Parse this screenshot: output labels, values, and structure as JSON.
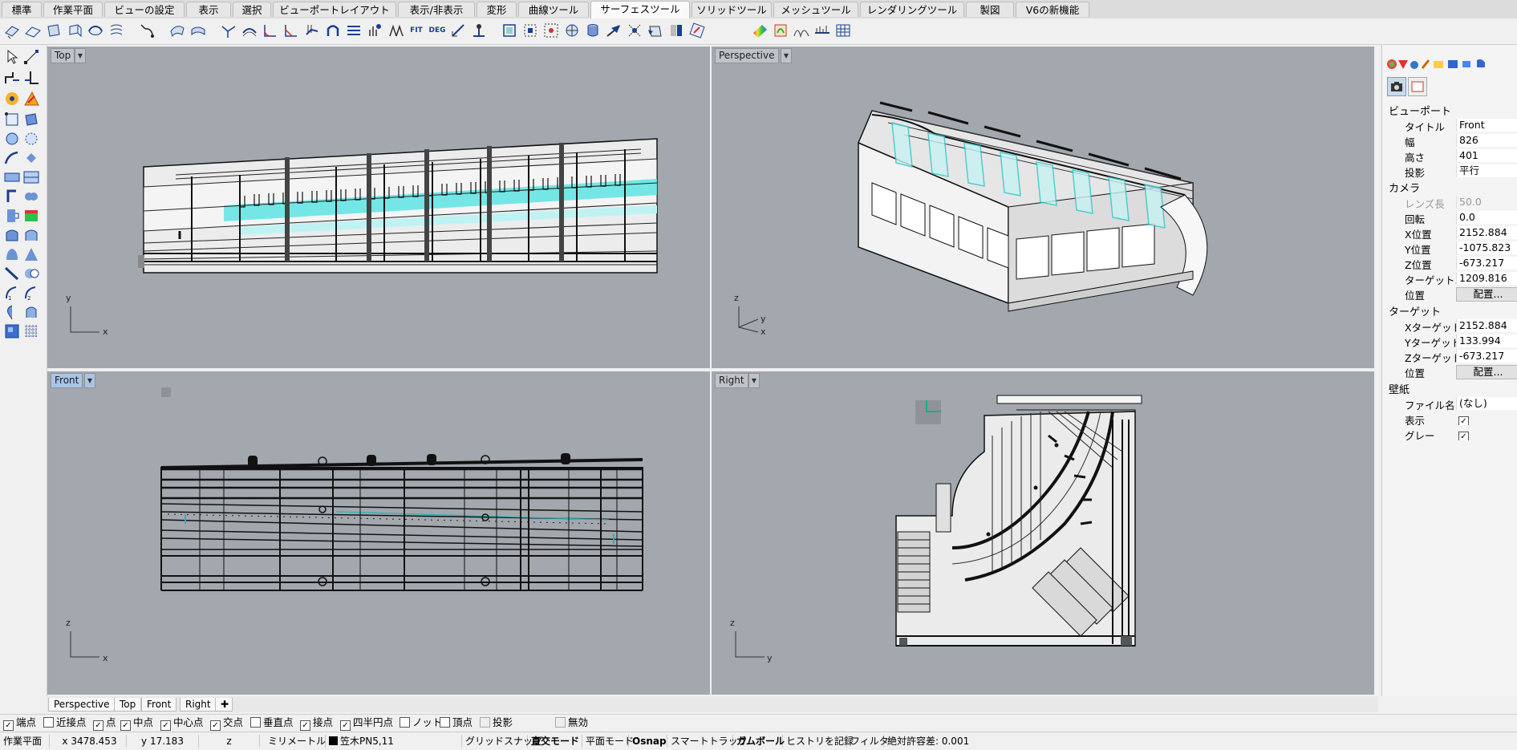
{
  "menu_tabs": [
    "標準",
    "作業平面",
    "ビューの設定",
    "表示",
    "選択",
    "ビューポートレイアウト",
    "表示/非表示",
    "変形",
    "曲線ツール",
    "サーフェスツール",
    "ソリッドツール",
    "メッシュツール",
    "レンダリングツール",
    "製図",
    "V6の新機能"
  ],
  "active_tab": "サーフェスツール",
  "toolbar_labels": {
    "fit": "FIT",
    "deg": "DEG"
  },
  "viewports": {
    "top": {
      "title": "Top",
      "axis_a": "y",
      "axis_b": "x"
    },
    "perspective": {
      "title": "Perspective",
      "axis_a": "z",
      "axis_b": "y",
      "axis_c": "x"
    },
    "front": {
      "title": "Front",
      "axis_a": "z",
      "axis_b": "x"
    },
    "right": {
      "title": "Right",
      "axis_a": "z",
      "axis_b": "y"
    }
  },
  "viewport_tabs": [
    "Perspective",
    "Top",
    "Front",
    "Right"
  ],
  "osnap": [
    {
      "label": "端点",
      "checked": true
    },
    {
      "label": "近接点",
      "checked": false
    },
    {
      "label": "点",
      "checked": true
    },
    {
      "label": "中点",
      "checked": true
    },
    {
      "label": "中心点",
      "checked": true
    },
    {
      "label": "交点",
      "checked": true
    },
    {
      "label": "垂直点",
      "checked": false
    },
    {
      "label": "接点",
      "checked": true
    },
    {
      "label": "四半円点",
      "checked": true
    },
    {
      "label": "ノット",
      "checked": false
    },
    {
      "label": "頂点",
      "checked": false
    },
    {
      "label": "投影",
      "checked": false,
      "disabled": true
    },
    {
      "label": "無効",
      "checked": false,
      "disabled": true
    }
  ],
  "status": {
    "cplane": "作業平面",
    "x": "x 3478.453",
    "y": "y 17.183",
    "z": "z",
    "units": "ミリメートル",
    "layer": "笠木PN5,11",
    "grid_snap": "グリッドスナップ",
    "ortho": "直交モード",
    "planar": "平面モード",
    "osnap": "Osnap",
    "smart_track": "スマートトラック",
    "gumball": "ガムボール",
    "history": "ヒストリを記録",
    "filter": "フィルタ",
    "tolerance": "絶対許容差: 0.001"
  },
  "panel": {
    "viewport_section": "ビューポート",
    "title_label": "タイトル",
    "title_value": "Front",
    "width_label": "幅",
    "width_value": "826",
    "height_label": "高さ",
    "height_value": "401",
    "projection_label": "投影",
    "projection_value": "平行",
    "camera_section": "カメラ",
    "lens_label": "レンズ長",
    "lens_value": "50.0",
    "rotation_label": "回転",
    "rotation_value": "0.0",
    "xpos_label": "X位置",
    "xpos_value": "2152.884",
    "ypos_label": "Y位置",
    "ypos_value": "-1075.823",
    "zpos_label": "Z位置",
    "zpos_value": "-673.217",
    "target_dist_label": "ターゲット...",
    "target_dist_value": "1209.816",
    "pos_label": "位置",
    "pos_button": "配置...",
    "target_section": "ターゲット",
    "xt_label": "Xターゲット",
    "xt_value": "2152.884",
    "yt_label": "Yターゲット",
    "yt_value": "133.994",
    "zt_label": "Zターゲット",
    "zt_value": "-673.217",
    "tpos_label": "位置",
    "tpos_button": "配置...",
    "wallpaper_section": "壁紙",
    "file_label": "ファイル名",
    "file_value": "(なし)",
    "show_label": "表示",
    "show_value": "✓",
    "gray_label": "グレー",
    "gray_value": "✓"
  },
  "colors": {
    "viewport_bg": "#a3a8ae",
    "cyan": "#22d3d3",
    "accent": "#1a3f8f"
  }
}
